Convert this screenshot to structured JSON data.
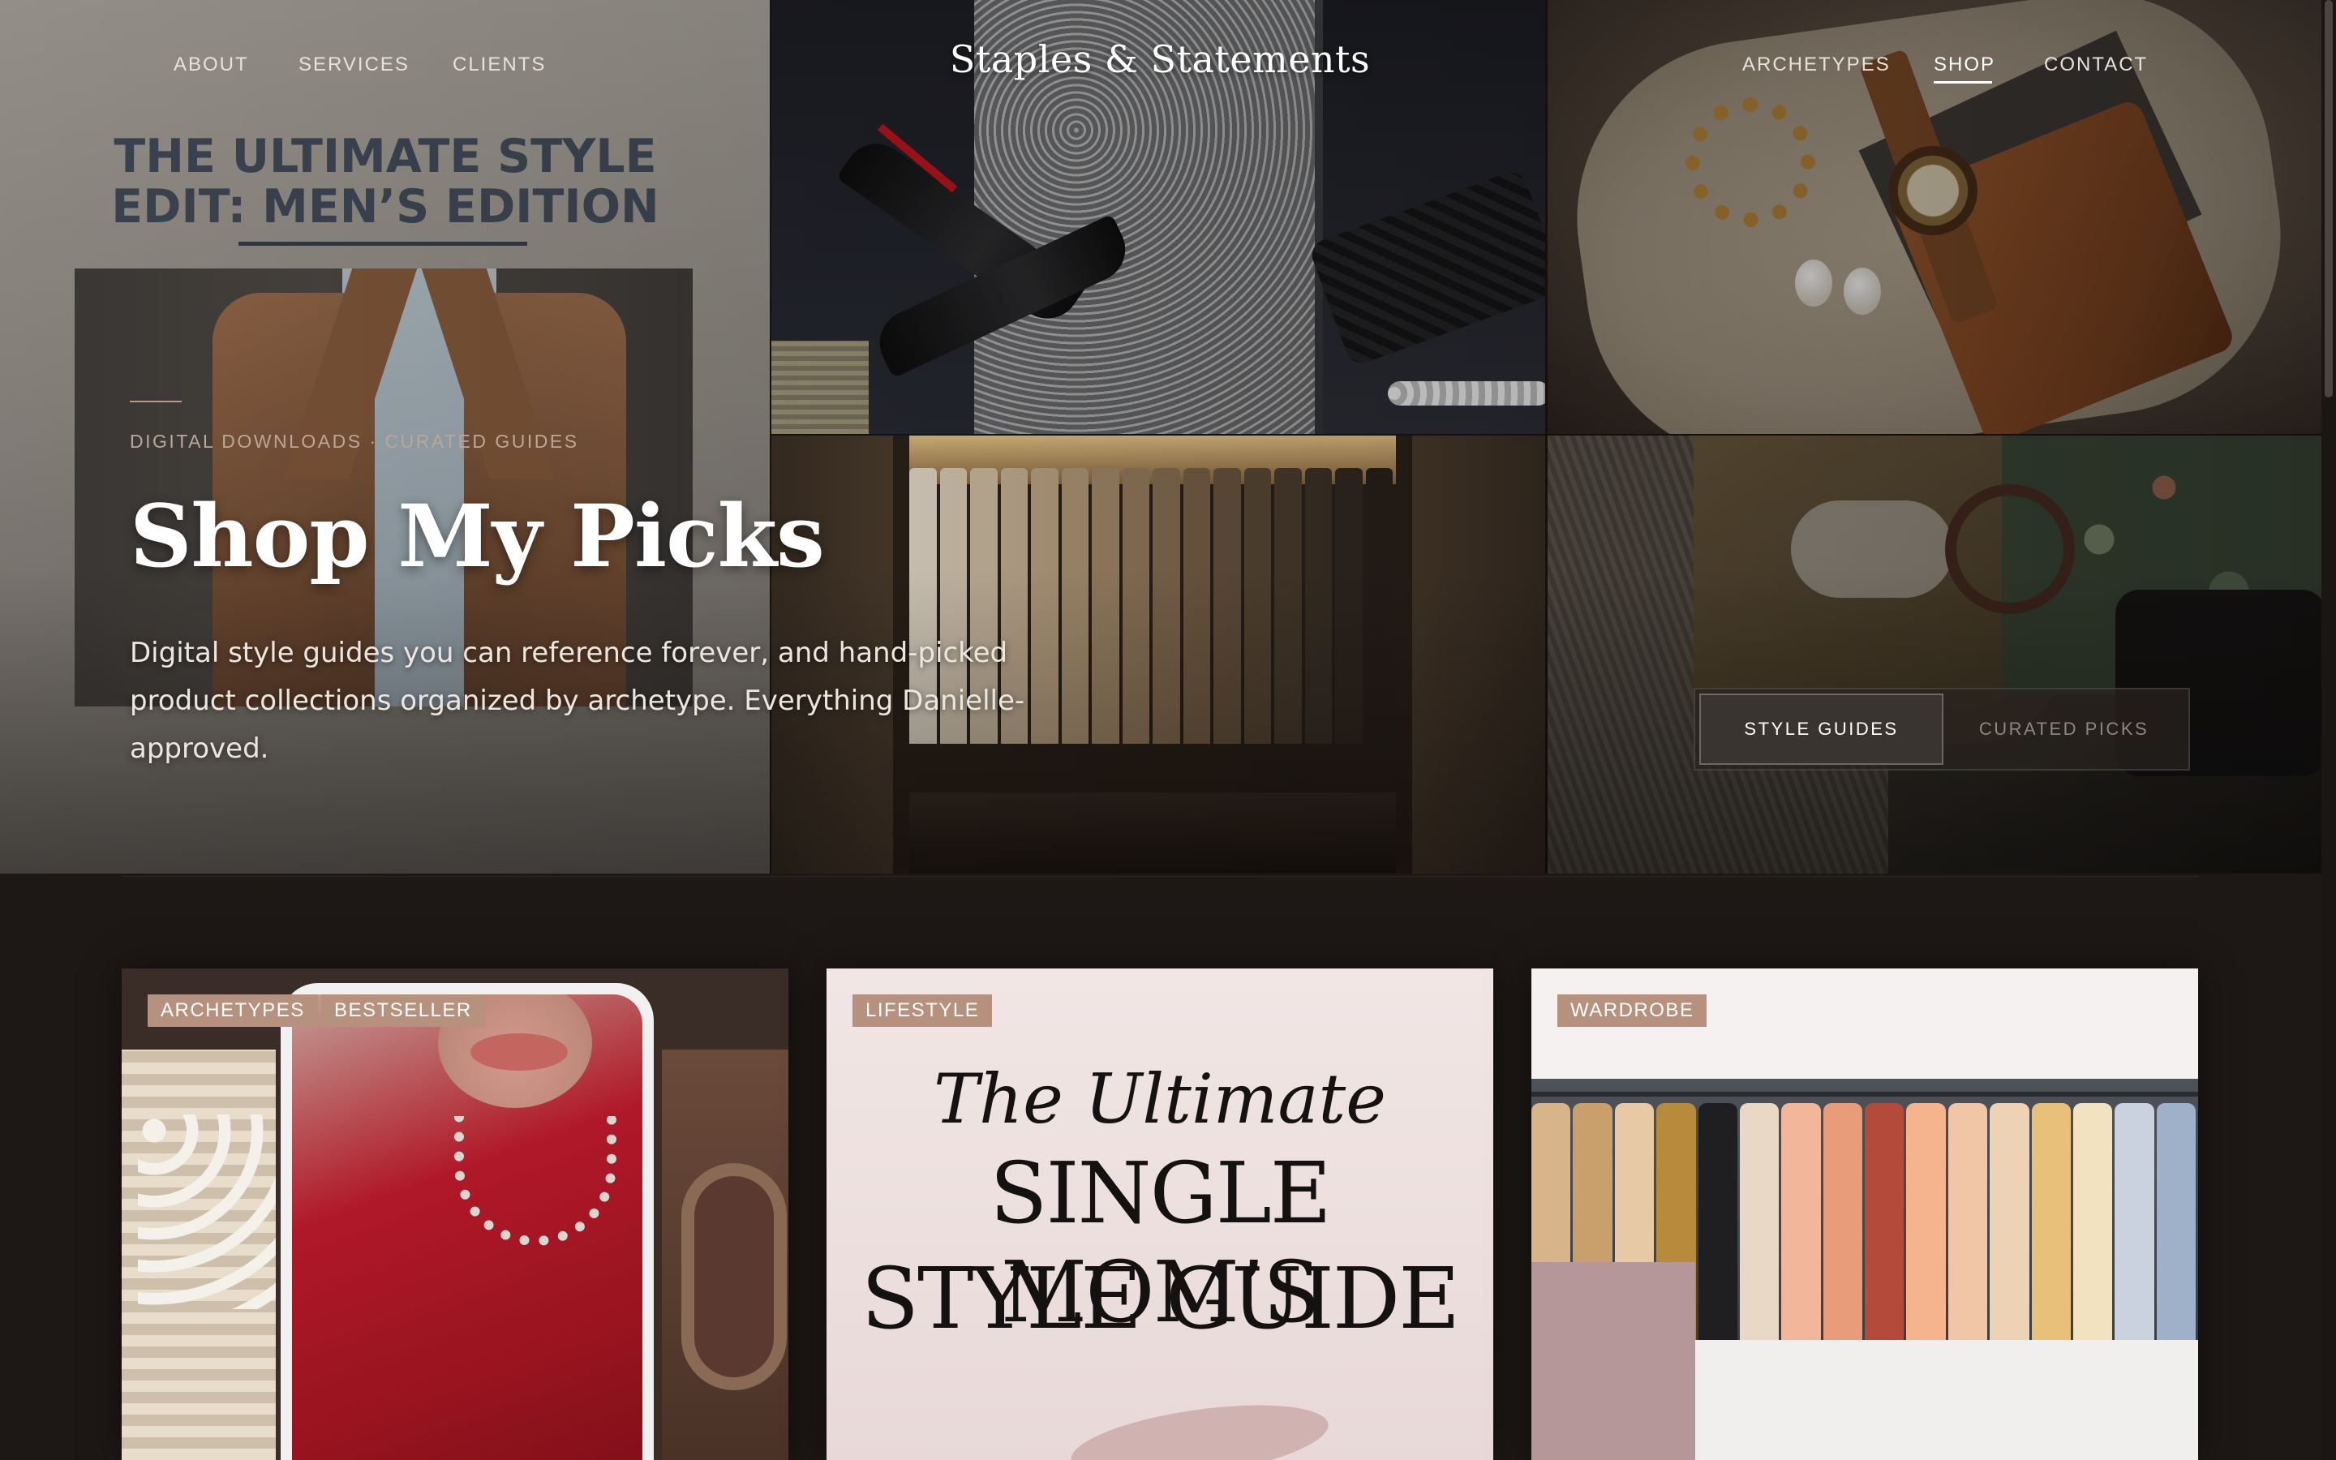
{
  "brand": "Staples & Statements",
  "nav": {
    "left": [
      "ABOUT",
      "SERVICES",
      "CLIENTS"
    ],
    "right": [
      "ARCHETYPES",
      "SHOP",
      "CONTACT"
    ],
    "active": "SHOP"
  },
  "hero": {
    "guide_cover_title": "THE ULTIMATE STYLE EDIT: MEN’S EDITION",
    "eyebrow": "DIGITAL DOWNLOADS · CURATED GUIDES",
    "title": "Shop My Picks",
    "description": "Digital style guides you can reference forever, and hand-picked product collections organized by archetype. Everything Danielle-approved."
  },
  "toggle": {
    "options": [
      "STYLE GUIDES",
      "CURATED PICKS"
    ],
    "active": "STYLE GUIDES"
  },
  "cards": [
    {
      "badges": [
        "ARCHETYPES",
        "BESTSELLER"
      ]
    },
    {
      "badges": [
        "LIFESTYLE"
      ],
      "cover_script": "The Ultimate",
      "cover_line1": "SINGLE MOM’S",
      "cover_line2": "STYLE GUIDE"
    },
    {
      "badges": [
        "WARDROBE"
      ]
    }
  ],
  "colors": {
    "page_bg": "#1d1816",
    "badge": "#b6927e",
    "eyebrow": "#b9a897",
    "toggle_active_bg": "#3a3431"
  }
}
